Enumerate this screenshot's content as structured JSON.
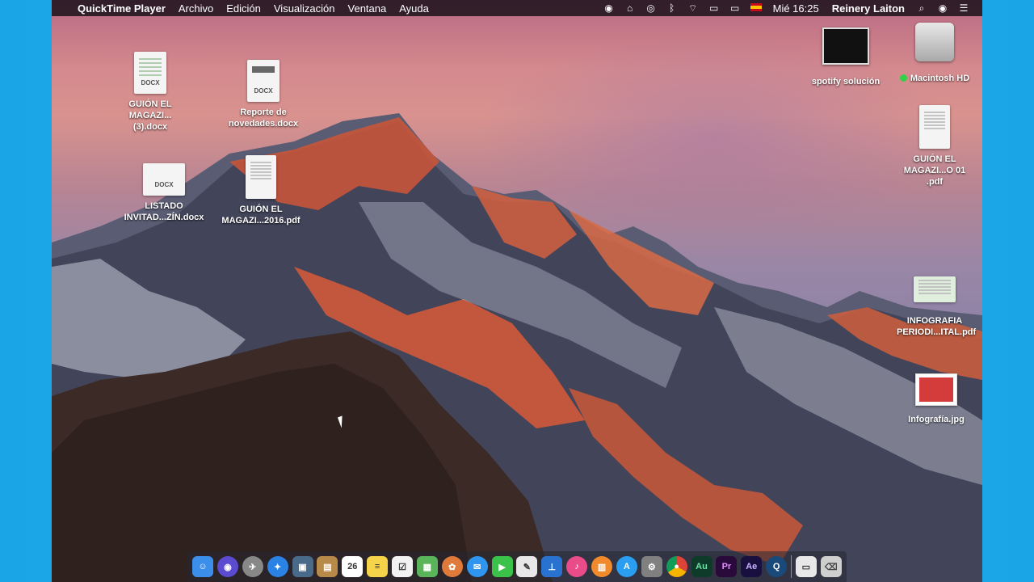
{
  "menubar": {
    "apple_icon": "",
    "app_name": "QuickTime Player",
    "menus": [
      "Archivo",
      "Edición",
      "Visualización",
      "Ventana",
      "Ayuda"
    ],
    "status_icons": [
      "record-icon",
      "airplay-like-icon",
      "circle-icon",
      "bluetooth-icon",
      "wifi-icon",
      "display-icon",
      "battery-icon",
      "flag-es-icon"
    ],
    "clock": "Mié 16:25",
    "user": "Reinery Laiton",
    "search_icon": "⌕",
    "siri_icon": "◉",
    "notifications_icon": "☰"
  },
  "desktop_icons": [
    {
      "label": "GUIÓN EL MAGAZI...(3).docx",
      "kind": "DOCX"
    },
    {
      "label": "Reporte de novedades.docx",
      "kind": "DOCX"
    },
    {
      "label": "LISTADO INVITAD...ZÍN.docx",
      "kind": "DOCX"
    },
    {
      "label": "GUIÓN EL MAGAZI...2016.pdf",
      "kind": "PDF"
    },
    {
      "label": "spotify solución",
      "kind": "image"
    },
    {
      "label": "Macintosh HD",
      "kind": "drive"
    },
    {
      "label": "GUIÓN EL MAGAZI...O 01 .pdf",
      "kind": "PDF"
    },
    {
      "label": "INFOGRAFIA PERIODI...ITAL.pdf",
      "kind": "PDF"
    },
    {
      "label": "Infografía.jpg",
      "kind": "JPG"
    }
  ],
  "dock": {
    "apps": [
      {
        "name": "finder",
        "glyph": "☺",
        "color": "#3b8eea"
      },
      {
        "name": "siri",
        "glyph": "◉",
        "color": "#5a4bd0"
      },
      {
        "name": "launchpad",
        "glyph": "✈",
        "color": "#888"
      },
      {
        "name": "safari",
        "glyph": "✦",
        "color": "#2a82e4"
      },
      {
        "name": "preview",
        "glyph": "▣",
        "color": "#4a6a8a"
      },
      {
        "name": "notebook",
        "glyph": "▤",
        "color": "#b88a4a"
      },
      {
        "name": "calendar",
        "glyph": "26",
        "color": "#ffffff"
      },
      {
        "name": "notes",
        "glyph": "≡",
        "color": "#f5d44a"
      },
      {
        "name": "reminders",
        "glyph": "☑",
        "color": "#f2f2f2"
      },
      {
        "name": "numbers",
        "glyph": "▦",
        "color": "#5ab45a"
      },
      {
        "name": "photos",
        "glyph": "✿",
        "color": "#e07a3a"
      },
      {
        "name": "messages",
        "glyph": "✉",
        "color": "#2f96f0"
      },
      {
        "name": "facetime",
        "glyph": "▶",
        "color": "#3bc24a"
      },
      {
        "name": "script-editor",
        "glyph": "✎",
        "color": "#e8e8e8"
      },
      {
        "name": "keynote",
        "glyph": "⊥",
        "color": "#2a72d0"
      },
      {
        "name": "itunes",
        "glyph": "♪",
        "color": "#ea4c89"
      },
      {
        "name": "ibooks",
        "glyph": "📖",
        "color": "#f08a2a"
      },
      {
        "name": "app-store",
        "glyph": "A",
        "color": "#2a9ef0"
      },
      {
        "name": "system-preferences",
        "glyph": "⚙",
        "color": "#808080"
      },
      {
        "name": "chrome",
        "glyph": "◎",
        "color": "#3cba54"
      },
      {
        "name": "audition",
        "glyph": "Au",
        "color": "#0f3b2a"
      },
      {
        "name": "premiere",
        "glyph": "Pr",
        "color": "#2a0a3a"
      },
      {
        "name": "after-effects",
        "glyph": "Ae",
        "color": "#1a1040"
      },
      {
        "name": "quicktime",
        "glyph": "Q",
        "color": "#1a4a7a"
      },
      {
        "name": "desktop-folder",
        "glyph": "▭",
        "color": "#e8e8e8"
      },
      {
        "name": "trash",
        "glyph": "🗑",
        "color": "#cfcfcf"
      }
    ]
  },
  "colors": {
    "outer_background": "#1fa9ea",
    "menubar": "#140e16"
  }
}
